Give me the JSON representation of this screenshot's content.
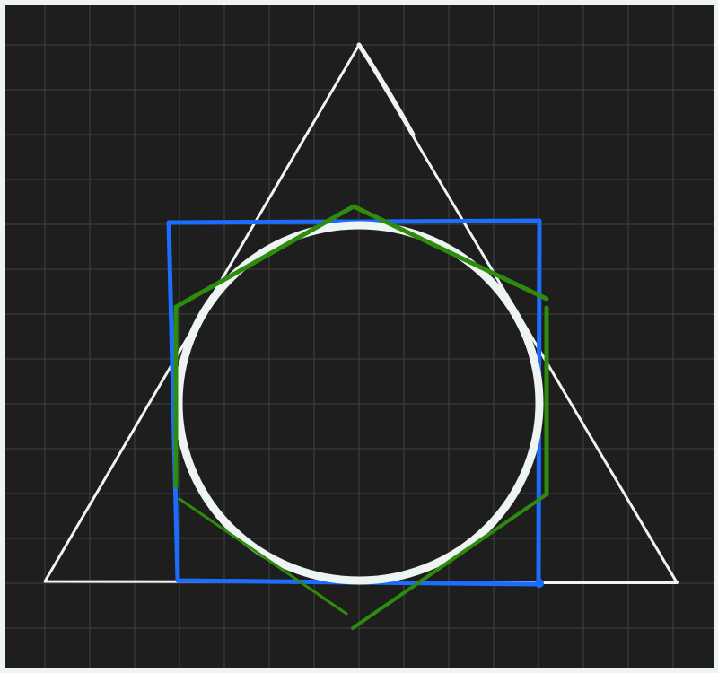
{
  "canvas": {
    "background": "#1e1e1e",
    "frame_color": "#eef4f1",
    "grid_color": "#3c3c3c"
  },
  "shapes": [
    {
      "id": "triangle",
      "kind": "triangle",
      "stroke": "#eef4f1"
    },
    {
      "id": "square",
      "kind": "square",
      "stroke": "#1a6dff"
    },
    {
      "id": "circle",
      "kind": "circle",
      "stroke": "#eef4f1"
    },
    {
      "id": "hexagon",
      "kind": "hexagon",
      "stroke": "#2e8b0e"
    }
  ]
}
